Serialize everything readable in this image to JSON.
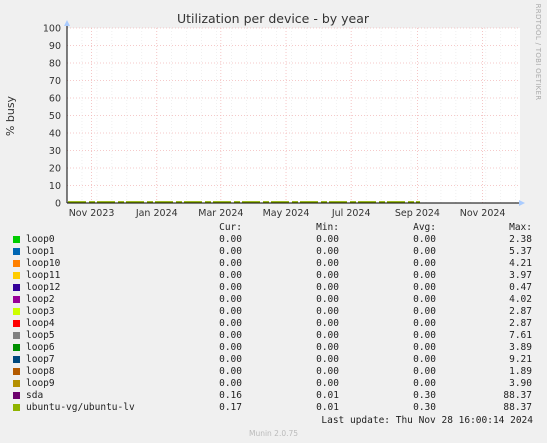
{
  "chart_data": {
    "type": "area",
    "title": "Utilization per device - by year",
    "ylabel": "% busy",
    "ylim": [
      0,
      100
    ],
    "yticks": [
      0,
      10,
      20,
      30,
      40,
      50,
      60,
      70,
      80,
      90,
      100
    ],
    "xlim": [
      "2023-10-09",
      "2024-12-06"
    ],
    "xticks": [
      {
        "label": "Nov 2023",
        "date": "2023-11-01"
      },
      {
        "label": "Jan 2024",
        "date": "2024-01-01"
      },
      {
        "label": "Mar 2024",
        "date": "2024-03-01"
      },
      {
        "label": "May 2024",
        "date": "2024-05-01"
      },
      {
        "label": "Jul 2024",
        "date": "2024-07-01"
      },
      {
        "label": "Sep 2024",
        "date": "2024-09-01"
      },
      {
        "label": "Nov 2024",
        "date": "2024-11-01"
      }
    ],
    "grid": true,
    "columns": [
      "Cur:",
      "Min:",
      "Avg:",
      "Max:"
    ],
    "series": [
      {
        "name": "loop0",
        "color": "#00cc00",
        "cur": "0.00",
        "min": "0.00",
        "avg": "0.00",
        "max": "2.38"
      },
      {
        "name": "loop1",
        "color": "#0066b3",
        "cur": "0.00",
        "min": "0.00",
        "avg": "0.00",
        "max": "5.37"
      },
      {
        "name": "loop10",
        "color": "#ff8000",
        "cur": "0.00",
        "min": "0.00",
        "avg": "0.00",
        "max": "4.21"
      },
      {
        "name": "loop11",
        "color": "#ffcc00",
        "cur": "0.00",
        "min": "0.00",
        "avg": "0.00",
        "max": "3.97"
      },
      {
        "name": "loop12",
        "color": "#330099",
        "cur": "0.00",
        "min": "0.00",
        "avg": "0.00",
        "max": "0.47"
      },
      {
        "name": "loop2",
        "color": "#990099",
        "cur": "0.00",
        "min": "0.00",
        "avg": "0.00",
        "max": "4.02"
      },
      {
        "name": "loop3",
        "color": "#ccff00",
        "cur": "0.00",
        "min": "0.00",
        "avg": "0.00",
        "max": "2.87"
      },
      {
        "name": "loop4",
        "color": "#ff0000",
        "cur": "0.00",
        "min": "0.00",
        "avg": "0.00",
        "max": "2.87"
      },
      {
        "name": "loop5",
        "color": "#808080",
        "cur": "0.00",
        "min": "0.00",
        "avg": "0.00",
        "max": "7.61"
      },
      {
        "name": "loop6",
        "color": "#008f00",
        "cur": "0.00",
        "min": "0.00",
        "avg": "0.00",
        "max": "3.89"
      },
      {
        "name": "loop7",
        "color": "#00487d",
        "cur": "0.00",
        "min": "0.00",
        "avg": "0.00",
        "max": "9.21"
      },
      {
        "name": "loop8",
        "color": "#b35a00",
        "cur": "0.00",
        "min": "0.00",
        "avg": "0.00",
        "max": "1.89"
      },
      {
        "name": "loop9",
        "color": "#b38f00",
        "cur": "0.00",
        "min": "0.00",
        "avg": "0.00",
        "max": "3.90"
      },
      {
        "name": "sda",
        "color": "#6b006b",
        "cur": "0.16",
        "min": "0.01",
        "avg": "0.30",
        "max": "88.37"
      },
      {
        "name": "ubuntu-vg/ubuntu-lv",
        "color": "#8fb300",
        "cur": "0.17",
        "min": "0.01",
        "avg": "0.30",
        "max": "88.37"
      }
    ],
    "baseline_level": 0.6
  },
  "side_label": "RRDTOOL / TOBI OETIKER",
  "last_update": "Last update: Thu Nov 28 16:00:14 2024",
  "footer": "Munin 2.0.75"
}
